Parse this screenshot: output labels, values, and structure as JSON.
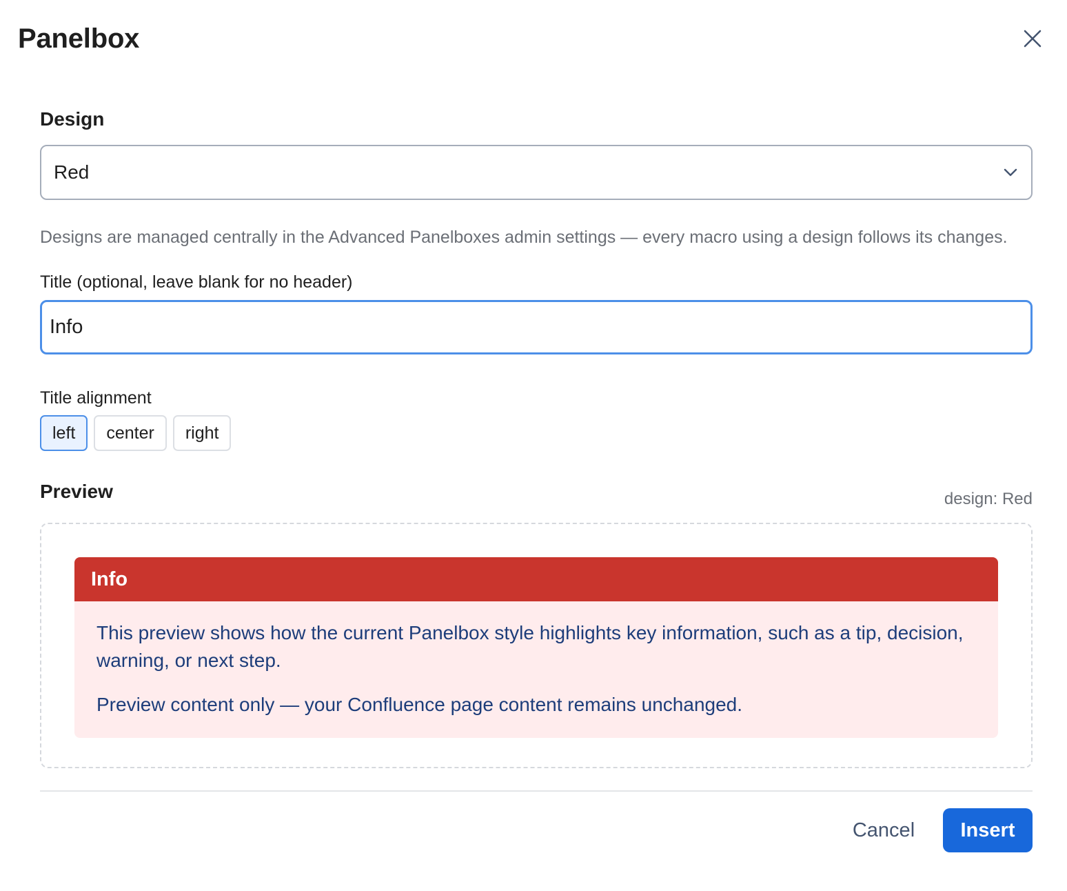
{
  "dialog": {
    "title": "Panelbox",
    "close_icon": "close-icon"
  },
  "design": {
    "label": "Design",
    "selected": "Red",
    "chevron_icon": "chevron-down-icon",
    "helper": "Designs are managed centrally in the Advanced Panelboxes admin settings — every macro using a design follows its changes."
  },
  "title_field": {
    "label": "Title (optional, leave blank for no header)",
    "value": "Info"
  },
  "alignment": {
    "label": "Title alignment",
    "options": [
      "left",
      "center",
      "right"
    ],
    "selected": "left"
  },
  "preview": {
    "label": "Preview",
    "meta": "design: Red",
    "panel": {
      "title": "Info",
      "paragraphs": [
        "This preview shows how the current Panelbox style highlights key information, such as a tip, decision, warning, or next step.",
        "Preview content only — your Confluence page content remains unchanged."
      ]
    }
  },
  "footer": {
    "cancel_label": "Cancel",
    "insert_label": "Insert"
  },
  "colors": {
    "panel_header": "#c9352d",
    "panel_body": "#ffeced",
    "primary": "#1868db",
    "focus": "#4c8fe8"
  }
}
